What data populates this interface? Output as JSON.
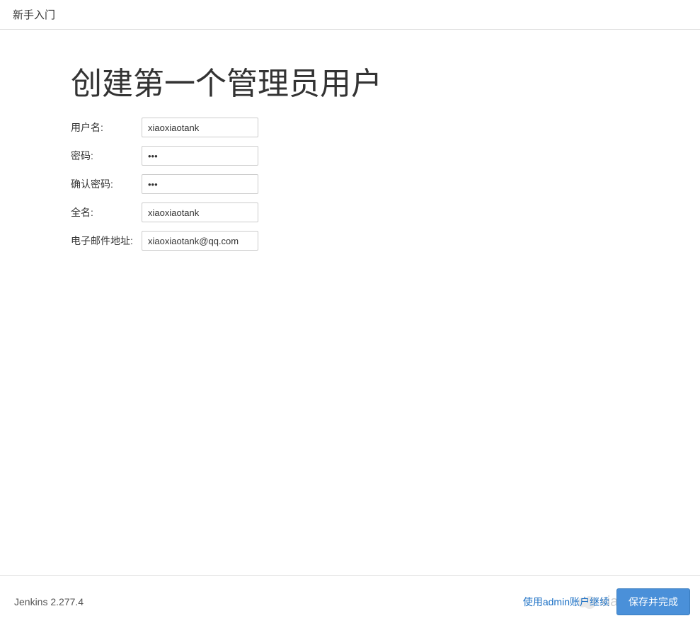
{
  "header": {
    "title": "新手入门"
  },
  "main": {
    "heading": "创建第一个管理员用户",
    "form": {
      "username": {
        "label": "用户名:",
        "value": "xiaoxiaotank"
      },
      "password": {
        "label": "密码:",
        "value": "•••"
      },
      "confirm_password": {
        "label": "确认密码:",
        "value": "•••"
      },
      "fullname": {
        "label": "全名:",
        "value": "xiaoxiaotank"
      },
      "email": {
        "label": "电子邮件地址:",
        "value": "xiaoxiaotank@qq.com"
      }
    }
  },
  "footer": {
    "version": "Jenkins 2.277.4",
    "skip_link": "使用admin账户继续",
    "primary_button": "保存并完成"
  },
  "watermark": {
    "text": "xiaoxiaotank"
  }
}
